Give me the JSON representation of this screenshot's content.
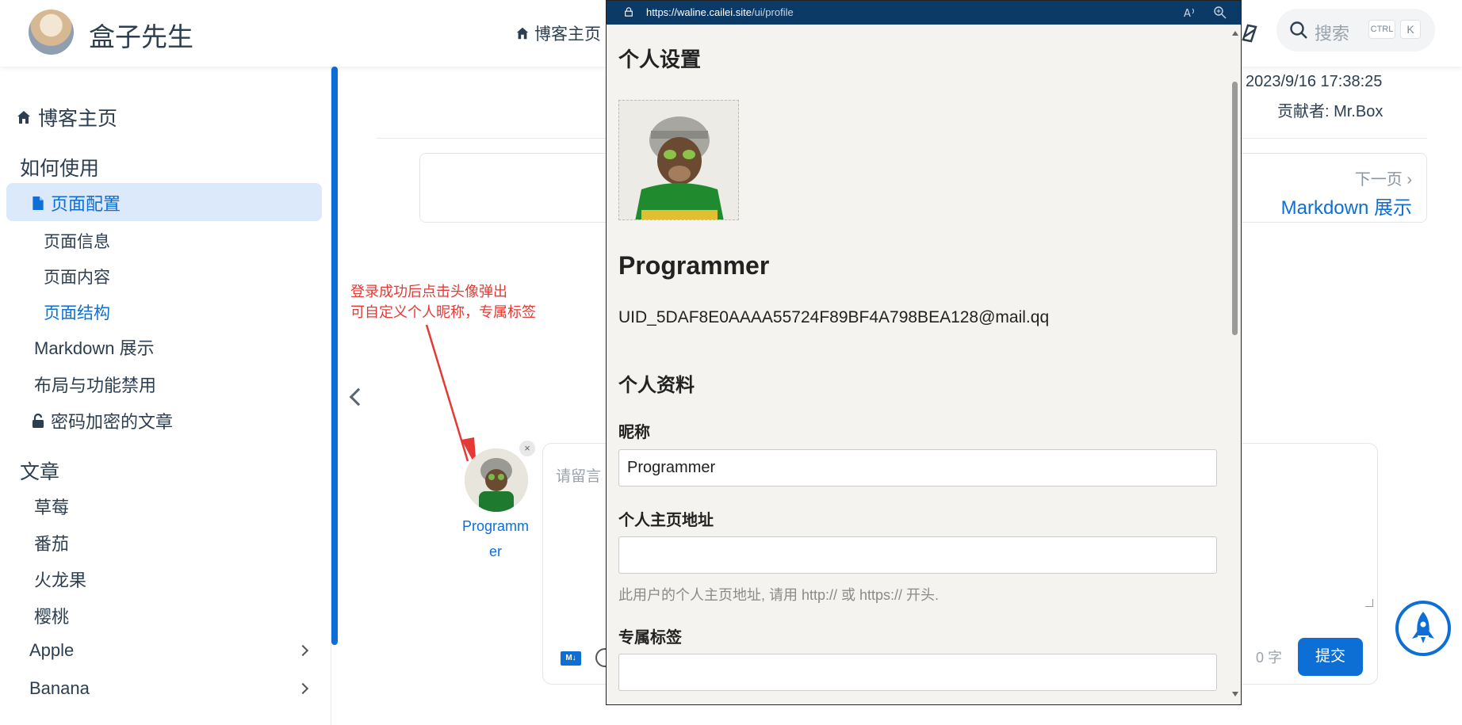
{
  "navbar": {
    "site_name": "盒子先生",
    "home_label": "博客主页",
    "search_placeholder": "搜索",
    "search_key_ctrl": "CTRL",
    "search_key_k": "K"
  },
  "sidebar": {
    "home": "博客主页",
    "section_how": "如何使用",
    "items": [
      {
        "label": "页面配置",
        "active": true
      },
      {
        "label": "页面信息"
      },
      {
        "label": "页面内容"
      },
      {
        "label": "页面结构"
      },
      {
        "label": "Markdown 展示"
      },
      {
        "label": "布局与功能禁用"
      },
      {
        "label": "密码加密的文章"
      }
    ],
    "section_articles": "文章",
    "articles": [
      "草莓",
      "番茄",
      "火龙果",
      "樱桃",
      "Apple",
      "Banana"
    ]
  },
  "page_meta": {
    "date": "2023/9/16 17:38:25",
    "author": "贡献者: Mr.Box"
  },
  "pager": {
    "next_hint": "下一页 ›",
    "next_title": "Markdown 展示"
  },
  "annotation": {
    "line1": "登录成功后点击头像弹出",
    "line2": "可自定义个人昵称，专属标签"
  },
  "comment": {
    "user_line1": "Programm",
    "user_line2": "er",
    "placeholder": "请留言",
    "word_count": "0 字",
    "submit": "提交",
    "close": "×",
    "md_badge": "M↓"
  },
  "popup": {
    "url_host": "https://waline.cailei.site",
    "url_path": "/ui/profile",
    "title_settings": "个人设置",
    "name": "Programmer",
    "email": "UID_5DAF8E0AAAA55724F89BF4A798BEA128@mail.qq",
    "title_profile": "个人资料",
    "nickname_label": "昵称",
    "nickname_value": "Programmer",
    "homepage_label": "个人主页地址",
    "homepage_value": "",
    "homepage_hint": "此用户的个人主页地址, 请用 http:// 或 https:// 开头.",
    "tag_label": "专属标签",
    "tag_value": ""
  },
  "colors": {
    "accent": "#0d6fd6",
    "annotation": "#e53935",
    "popup_bar": "#0b3a67",
    "popup_bg": "#f4f3ef"
  }
}
